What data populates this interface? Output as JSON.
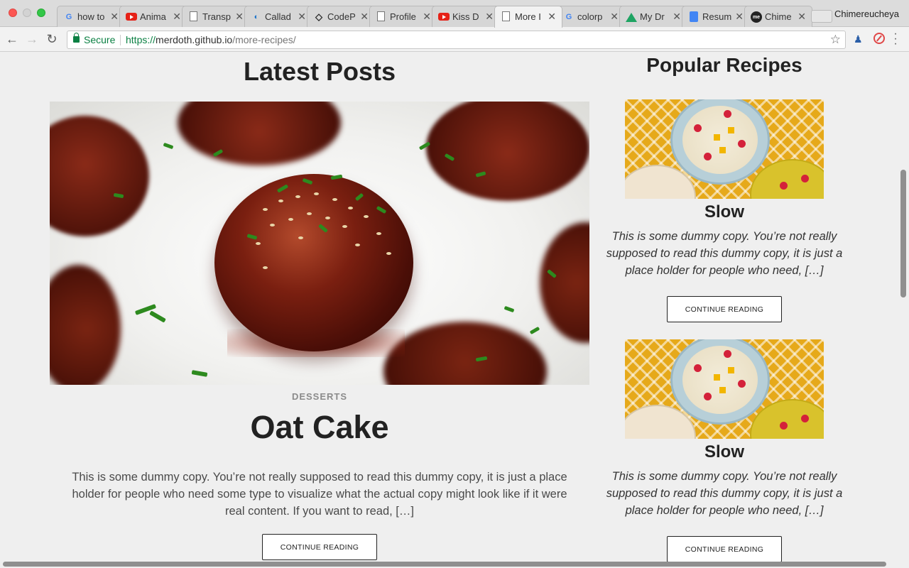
{
  "browser": {
    "tabs": [
      {
        "label": "how to",
        "icon": "google-icon"
      },
      {
        "label": "Anima",
        "icon": "youtube-icon"
      },
      {
        "label": "Transp",
        "icon": "document-icon"
      },
      {
        "label": "Callad",
        "icon": "calladus-icon"
      },
      {
        "label": "CodeP",
        "icon": "codepen-icon"
      },
      {
        "label": "Profile",
        "icon": "document-icon"
      },
      {
        "label": "Kiss D",
        "icon": "youtube-icon"
      },
      {
        "label": "More I",
        "icon": "document-icon",
        "active": true
      },
      {
        "label": "colorp",
        "icon": "google-icon"
      },
      {
        "label": "My Dr",
        "icon": "google-drive-icon"
      },
      {
        "label": "Resum",
        "icon": "google-docs-icon"
      },
      {
        "label": "Chime",
        "icon": "medium-icon"
      }
    ],
    "profile_name": "Chimereucheya",
    "secure_label": "Secure",
    "url_scheme": "https://",
    "url_host": "merdoth.github.io",
    "url_path": "/more-recipes/"
  },
  "main": {
    "heading": "Latest Posts",
    "post": {
      "category": "DESSERTS",
      "title": "Oat Cake",
      "excerpt": "This is some dummy copy. You’re not really supposed to read this dummy copy, it is just a place holder for people who need some type to visualize what the actual copy might look like if it were real content. If you want to read, […]",
      "button": "CONTINUE READING"
    }
  },
  "sidebar": {
    "heading": "Popular Recipes",
    "recipes": [
      {
        "title": "Slow",
        "text": "This is some dummy copy. You’re not really supposed to read this dummy copy, it is just a place holder for people who need, […]",
        "button": "CONTINUE READING"
      },
      {
        "title": "Slow",
        "text": "This is some dummy copy. You’re not really supposed to read this dummy copy, it is just a place holder for people who need, […]",
        "button": "CONTINUE READING"
      }
    ]
  },
  "colors": {
    "page_background": "#efefef",
    "secure_green": "#0b8043",
    "heading_text": "#222222"
  }
}
